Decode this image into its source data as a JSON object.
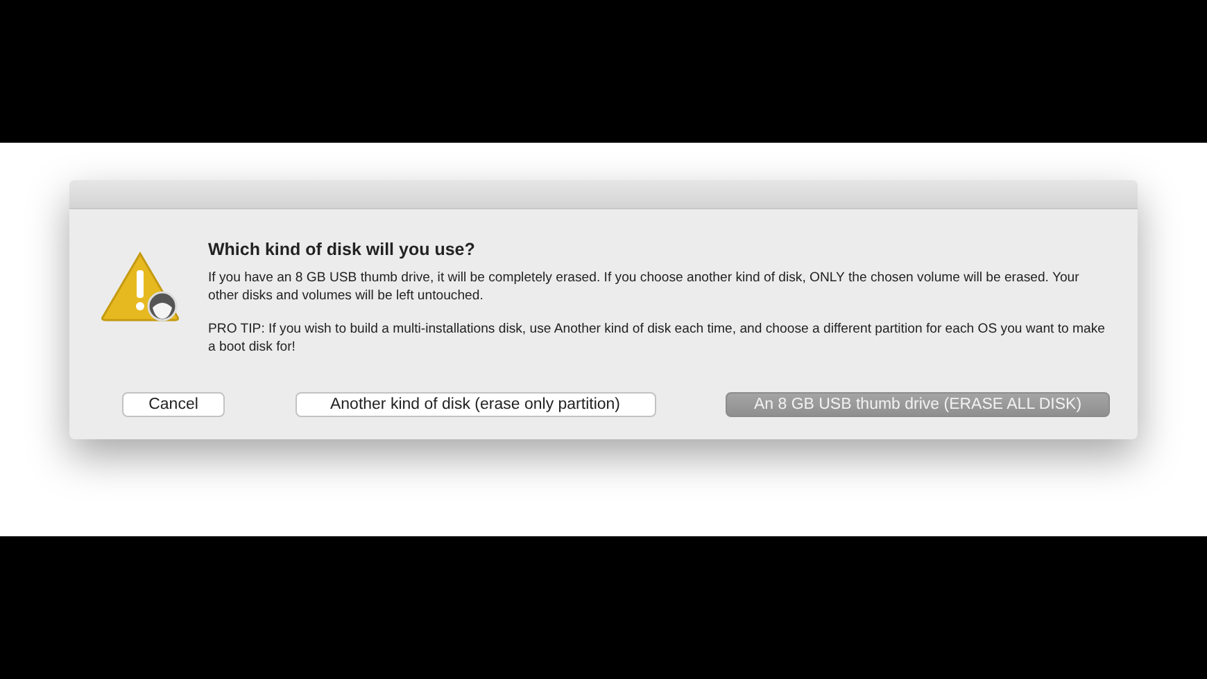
{
  "dialog": {
    "title": "Which kind of disk will you use?",
    "paragraphs": [
      "If you have an 8 GB USB thumb drive, it will be completely erased. If you choose another kind of disk, ONLY the chosen volume will be erased. Your other disks and volumes will be left untouched.",
      "PRO TIP: If you wish to build a multi-installations disk, use Another kind of disk each time, and choose a different partition for each OS you want to make a boot disk for!"
    ],
    "buttons": [
      {
        "label": "Cancel",
        "default": false
      },
      {
        "label": "Another kind of disk (erase only partition)",
        "default": false
      },
      {
        "label": "An 8 GB USB thumb drive (ERASE ALL DISK)",
        "default": true
      }
    ]
  }
}
